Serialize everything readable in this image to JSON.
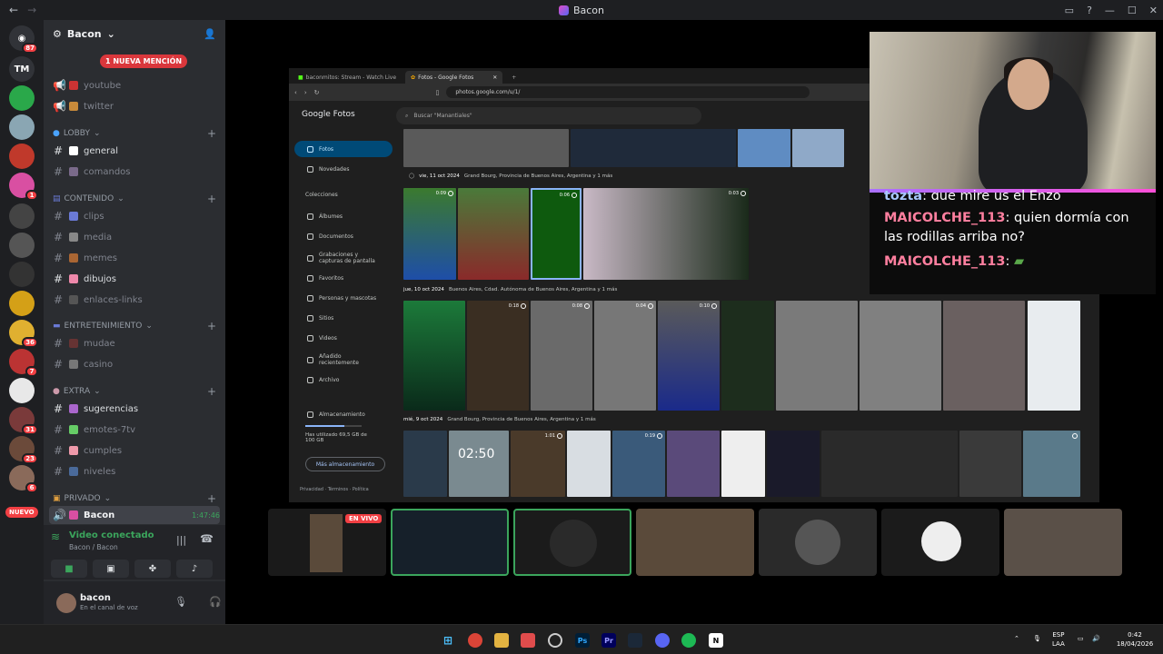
{
  "window": {
    "title": "Bacon"
  },
  "server": {
    "name": "Bacon",
    "mention": "1 NUEVA MENCIÓN"
  },
  "guild_badges": {
    "g1": "87",
    "tm": "TM",
    "g6": "1",
    "g13": "36",
    "g14": "7",
    "g16": "31",
    "g17": "23",
    "g18": "6",
    "nuevo": "NUEVO"
  },
  "channels_top": [
    {
      "name": "youtube"
    },
    {
      "name": "twitter"
    }
  ],
  "categories": {
    "lobby": "LOBBY",
    "contenido": "CONTENIDO",
    "entretenimiento": "ENTRETENIMIENTO",
    "extra": "EXTRA",
    "privado": "PRIVADO"
  },
  "channels": {
    "general": "general",
    "comandos": "comandos",
    "clips": "clips",
    "media": "media",
    "memes": "memes",
    "dibujos": "dibujos",
    "enlaces": "enlaces-links",
    "mudae": "mudae",
    "casino": "casino",
    "sugerencias": "sugerencias",
    "emotes": "emotes-7tv",
    "cumples": "cumples",
    "niveles": "niveles"
  },
  "voice_channel": {
    "name": "Bacon",
    "time": "1:47:46"
  },
  "voice_status": {
    "title": "Video conectado",
    "sub": "Bacon / Bacon"
  },
  "user": {
    "name": "bacon",
    "status": "En el canal de voz"
  },
  "browser": {
    "tab1": "baconmitos: Stream - Watch Live",
    "tab2": "Fotos - Google Fotos",
    "url": "photos.google.com/u/1/",
    "brand": "Google Fotos",
    "search_placeholder": "Buscar \"Manantiales\"",
    "side": {
      "fotos": "Fotos",
      "novedades": "Novedades",
      "colecciones": "Colecciones",
      "albumes": "Álbumes",
      "documentos": "Documentos",
      "grabaciones": "Grabaciones y capturas de pantalla",
      "favoritos": "Favoritos",
      "personas": "Personas y mascotas",
      "sitios": "Sitios",
      "videos": "Videos",
      "anadido": "Añadido recientemente",
      "archivo": "Archivo",
      "almacenamiento": "Almacenamiento",
      "usado": "Has utilizado 69,5 GB de 100 GB",
      "mas": "Más almacenamiento",
      "footer": "Privacidad · Términos · Política"
    },
    "dates": {
      "d1": "vie, 11 oct 2024",
      "d1loc": "Grand Bourg, Provincia de Buenos Aires, Argentina y 1 más",
      "d2": "jue, 10 oct 2024",
      "d2loc": "Buenos Aires, Cdad. Autónoma de Buenos Aires, Argentina y 1 más",
      "d3": "mié, 9 oct 2024",
      "d3loc": "Grand Bourg, Provincia de Buenos Aires, Argentina y 1 más"
    },
    "durations": {
      "a": "0:09",
      "b": "0:06",
      "c": "0:03",
      "d": "0:18",
      "e": "0:08",
      "f": "0:04",
      "g": "0:10",
      "h": "1:01",
      "i": "0:19",
      "j": "02:50"
    }
  },
  "chat": {
    "m0_user": "tozta",
    "m0_text": "que mire us el Enzo",
    "m1_user": "MAICOLCHE_113",
    "m1_text": "quien dormía con las rodillas arriba no?",
    "m2_user": "MAICOLCHE_113",
    "m2_text": ""
  },
  "stage": {
    "live": "EN VIVO"
  },
  "taskbar": {
    "lang1": "ESP",
    "lang2": "LAA",
    "time": "0:42",
    "date": "18/04/2026"
  }
}
